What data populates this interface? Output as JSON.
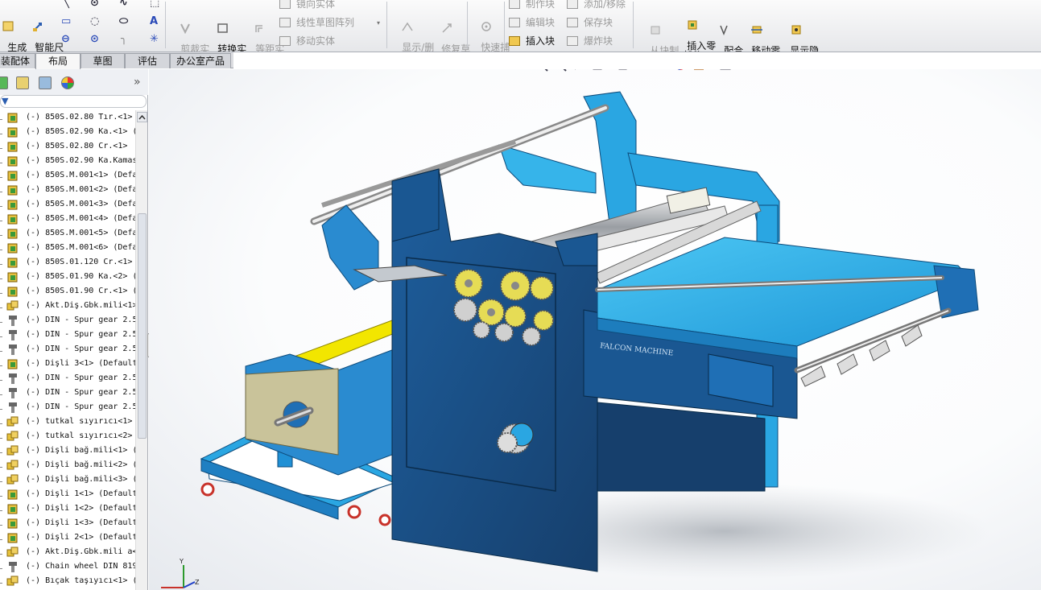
{
  "ribbon": {
    "groups": [
      {
        "name": "layout",
        "buttons": [
          {
            "name": "generate-layout-button",
            "label": "生成\n布局"
          },
          {
            "name": "smart-dimension-button",
            "label": "智能尺\n寸"
          }
        ]
      },
      {
        "name": "edit",
        "buttons": [
          {
            "name": "trim-entity-button",
            "label": "剪裁实\n体(T)",
            "disabled": true
          },
          {
            "name": "convert-entity-button",
            "label": "转换实\n体引用",
            "disabled": false
          },
          {
            "name": "offset-entity-button",
            "label": "等距实\n体",
            "disabled": true
          }
        ]
      },
      {
        "name": "pattern",
        "items": [
          {
            "name": "mirror-entity-button",
            "label": "镜向实体"
          },
          {
            "name": "linear-pattern-button",
            "label": "线性草图阵列"
          },
          {
            "name": "move-entity-button",
            "label": "移动实体"
          }
        ]
      },
      {
        "name": "display",
        "buttons": [
          {
            "name": "show-delete-relations-button",
            "label": "显示/删\n除几..."
          },
          {
            "name": "repair-sketch-button",
            "label": "修复草\n图"
          },
          {
            "name": "quick-snap-button",
            "label": "快速捕\n捉"
          }
        ]
      },
      {
        "name": "block",
        "items": [
          {
            "name": "make-block-button",
            "label": "制作块",
            "disabled": true
          },
          {
            "name": "edit-block-button",
            "label": "编辑块",
            "disabled": true
          },
          {
            "name": "insert-block-button",
            "label": "插入块",
            "disabled": false
          },
          {
            "name": "add-remove-button",
            "label": "添加/移除",
            "disabled": true
          },
          {
            "name": "save-block-button",
            "label": "保存块",
            "disabled": true
          },
          {
            "name": "explode-block-button",
            "label": "爆炸块",
            "disabled": true
          }
        ]
      },
      {
        "name": "assembly",
        "buttons": [
          {
            "name": "make-part-from-block-button",
            "label": "从块制\n作零件",
            "disabled": true
          },
          {
            "name": "insert-part-button",
            "label": "插入零\n部件",
            "disabled": false
          },
          {
            "name": "mate-button",
            "label": "配合",
            "disabled": false
          },
          {
            "name": "move-component-button",
            "label": "移动零\n部件",
            "disabled": false
          },
          {
            "name": "show-hidden-components-button",
            "label": "显示隐\n藏的零\n部件",
            "disabled": false
          }
        ]
      }
    ]
  },
  "tabs": [
    {
      "label": "装配体",
      "active": false
    },
    {
      "label": "布局",
      "active": true
    },
    {
      "label": "草图",
      "active": false
    },
    {
      "label": "评估",
      "active": false
    },
    {
      "label": "办公室产品",
      "active": false
    }
  ],
  "tree": {
    "items": [
      {
        "text": "(-) 850S.02.80 Tır.<1>",
        "icon": "part-icon"
      },
      {
        "text": "(-) 850S.02.90 Ka.<1> (",
        "icon": "part-icon"
      },
      {
        "text": "(-) 850S.02.80 Cr.<1>",
        "icon": "part-icon"
      },
      {
        "text": "(-) 850S.02.90 Ka.Kamas",
        "icon": "part-icon"
      },
      {
        "text": "(-) 850S.M.001<1> (Defa",
        "icon": "part-icon"
      },
      {
        "text": "(-) 850S.M.001<2> (Defa",
        "icon": "part-icon"
      },
      {
        "text": "(-) 850S.M.001<3> (Defa",
        "icon": "part-icon"
      },
      {
        "text": "(-) 850S.M.001<4> (Defa",
        "icon": "part-icon"
      },
      {
        "text": "(-) 850S.M.001<5> (Defa",
        "icon": "part-icon"
      },
      {
        "text": "(-) 850S.M.001<6> (Defa",
        "icon": "part-icon"
      },
      {
        "text": "(-) 850S.01.120 Cr.<1>",
        "icon": "part-icon"
      },
      {
        "text": "(-) 850S.01.90 Ka.<2> (",
        "icon": "part-icon"
      },
      {
        "text": "(-) 850S.01.90 Cr.<1> (",
        "icon": "part-icon"
      },
      {
        "text": "(-) Akt.Diş.Gbk.mili<1>",
        "icon": "subassembly-icon"
      },
      {
        "text": "(-) DIN - Spur gear 2.5",
        "icon": "toolbox-part-icon"
      },
      {
        "text": "(-) DIN - Spur gear 2.5",
        "icon": "toolbox-part-icon"
      },
      {
        "text": "(-) DIN - Spur gear 2.5",
        "icon": "toolbox-part-icon"
      },
      {
        "text": "(-) Dişli 3<1> (Default",
        "icon": "part-icon"
      },
      {
        "text": "(-) DIN - Spur gear 2.5",
        "icon": "toolbox-part-icon"
      },
      {
        "text": "(-) DIN - Spur gear 2.5",
        "icon": "toolbox-part-icon"
      },
      {
        "text": "(-) DIN - Spur gear 2.5",
        "icon": "toolbox-part-icon"
      },
      {
        "text": "(-) tutkal sıyırıcı<1> (De",
        "icon": "subassembly-icon"
      },
      {
        "text": "(-) tutkal sıyırıcı<2> (De",
        "icon": "subassembly-icon"
      },
      {
        "text": "(-) Dişli bağ.mili<1> (",
        "icon": "subassembly-icon"
      },
      {
        "text": "(-) Dişli bağ.mili<2> (",
        "icon": "subassembly-icon"
      },
      {
        "text": "(-) Dişli bağ.mili<3> (",
        "icon": "subassembly-icon"
      },
      {
        "text": "(-) Dişli 1<1> (Default",
        "icon": "part-icon"
      },
      {
        "text": "(-) Dişli 1<2> (Default",
        "icon": "part-icon"
      },
      {
        "text": "(-) Dişli 1<3> (Default",
        "icon": "part-icon"
      },
      {
        "text": "(-) Dişli 2<1> (Default",
        "icon": "part-icon"
      },
      {
        "text": "(-) Akt.Diş.Gbk.mili a<",
        "icon": "subassembly-icon"
      },
      {
        "text": "(-) Chain wheel DIN 819",
        "icon": "toolbox-part-icon"
      },
      {
        "text": "(-) Bıçak taşıyıcı<1> (Def",
        "icon": "subassembly-icon"
      }
    ]
  },
  "viewport": {
    "machine_label": "FALCON MACHINE",
    "triad_labels": {
      "y": "Y",
      "z": "Z"
    }
  },
  "colors": {
    "machine_blue": "#1f6fb5",
    "machine_dark": "#0f3d66",
    "table_cyan": "#2fb0e8",
    "gear_yellow": "#e6dc55",
    "plate_olive": "#c9c39a",
    "accent_yellow": "#f2e600"
  }
}
